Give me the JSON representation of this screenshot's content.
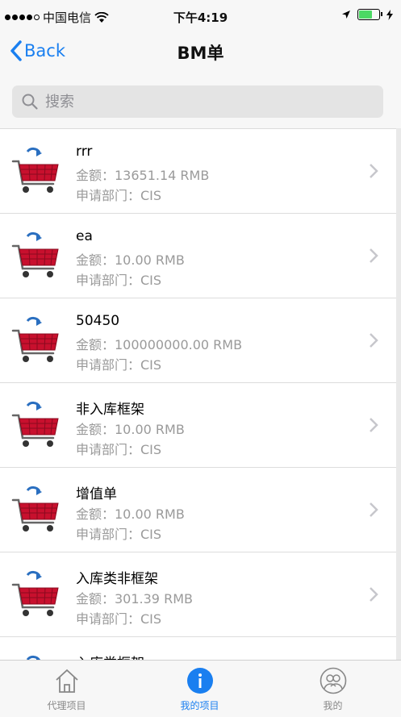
{
  "status": {
    "carrier": "中国电信",
    "time": "下午4:19"
  },
  "nav": {
    "back_label": "Back",
    "title": "BM单"
  },
  "search": {
    "placeholder": "搜索"
  },
  "items": [
    {
      "title": "rrr",
      "amount": "金额：13651.14 RMB",
      "dept": "申请部门：CIS"
    },
    {
      "title": "ea",
      "amount": "金额：10.00 RMB",
      "dept": "申请部门：CIS"
    },
    {
      "title": "50450",
      "amount": "金额：100000000.00 RMB",
      "dept": "申请部门：CIS"
    },
    {
      "title": "非入库框架",
      "amount": "金额：10.00 RMB",
      "dept": "申请部门：CIS"
    },
    {
      "title": "增值单",
      "amount": "金额：10.00 RMB",
      "dept": "申请部门：CIS"
    },
    {
      "title": "入库类非框架",
      "amount": "金额：301.39 RMB",
      "dept": "申请部门：CIS"
    },
    {
      "title": "入库类框架",
      "amount": "",
      "dept": ""
    }
  ],
  "tabs": [
    {
      "label": "代理项目",
      "icon": "home-icon"
    },
    {
      "label": "我的项目",
      "icon": "info-icon"
    },
    {
      "label": "我的",
      "icon": "profile-icon"
    }
  ],
  "colors": {
    "accent": "#1a7ff0",
    "cart_red": "#c8102e",
    "battery_green": "#4cd964"
  }
}
